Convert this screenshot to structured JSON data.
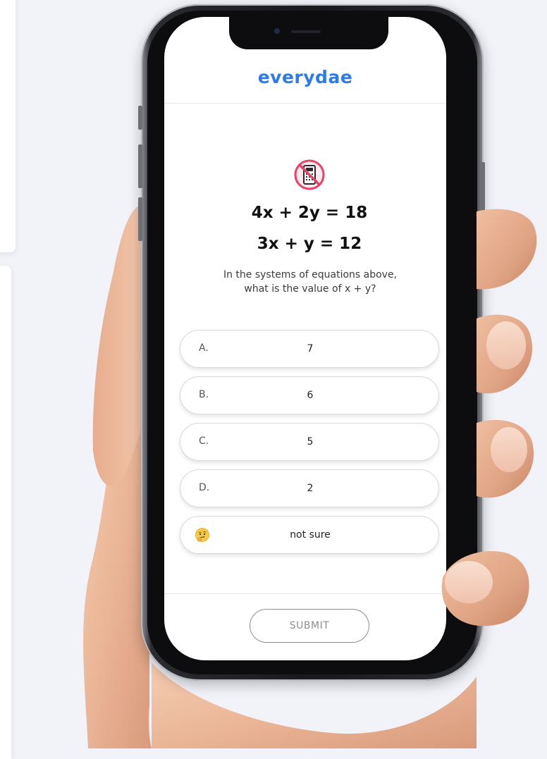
{
  "app": {
    "brand": "everydae",
    "brand_color": "#2b7bea"
  },
  "question": {
    "calculator_icon": "no-calculator-icon",
    "equation_1": "4x + 2y = 18",
    "equation_2": "3x + y = 12",
    "prompt_line_1": "In the systems of equations above,",
    "prompt_line_2": "what is the value of x + y?"
  },
  "options": [
    {
      "letter": "A.",
      "value": "7"
    },
    {
      "letter": "B.",
      "value": "6"
    },
    {
      "letter": "C.",
      "value": "5"
    },
    {
      "letter": "D.",
      "value": "2"
    },
    {
      "icon": "thinking-face-icon",
      "value": "not sure"
    }
  ],
  "submit_label": "SUBMIT"
}
